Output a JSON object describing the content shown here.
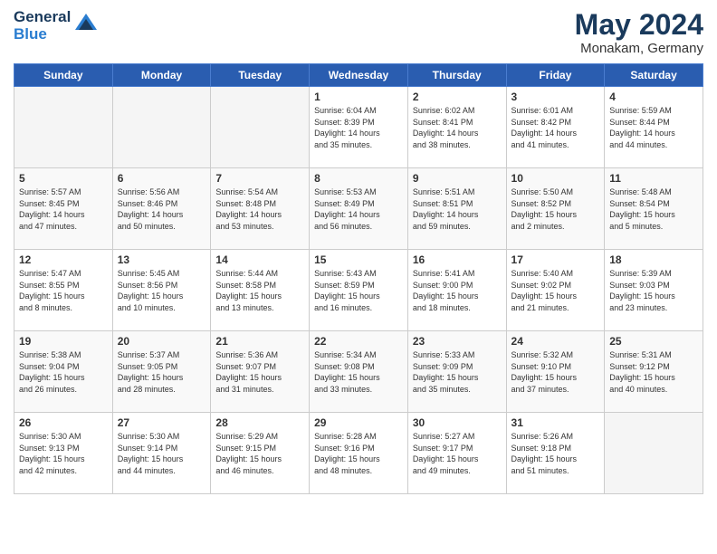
{
  "header": {
    "logo_line1": "General",
    "logo_line2": "Blue",
    "month_year": "May 2024",
    "location": "Monakam, Germany"
  },
  "weekdays": [
    "Sunday",
    "Monday",
    "Tuesday",
    "Wednesday",
    "Thursday",
    "Friday",
    "Saturday"
  ],
  "weeks": [
    [
      {
        "day": "",
        "info": ""
      },
      {
        "day": "",
        "info": ""
      },
      {
        "day": "",
        "info": ""
      },
      {
        "day": "1",
        "info": "Sunrise: 6:04 AM\nSunset: 8:39 PM\nDaylight: 14 hours\nand 35 minutes."
      },
      {
        "day": "2",
        "info": "Sunrise: 6:02 AM\nSunset: 8:41 PM\nDaylight: 14 hours\nand 38 minutes."
      },
      {
        "day": "3",
        "info": "Sunrise: 6:01 AM\nSunset: 8:42 PM\nDaylight: 14 hours\nand 41 minutes."
      },
      {
        "day": "4",
        "info": "Sunrise: 5:59 AM\nSunset: 8:44 PM\nDaylight: 14 hours\nand 44 minutes."
      }
    ],
    [
      {
        "day": "5",
        "info": "Sunrise: 5:57 AM\nSunset: 8:45 PM\nDaylight: 14 hours\nand 47 minutes."
      },
      {
        "day": "6",
        "info": "Sunrise: 5:56 AM\nSunset: 8:46 PM\nDaylight: 14 hours\nand 50 minutes."
      },
      {
        "day": "7",
        "info": "Sunrise: 5:54 AM\nSunset: 8:48 PM\nDaylight: 14 hours\nand 53 minutes."
      },
      {
        "day": "8",
        "info": "Sunrise: 5:53 AM\nSunset: 8:49 PM\nDaylight: 14 hours\nand 56 minutes."
      },
      {
        "day": "9",
        "info": "Sunrise: 5:51 AM\nSunset: 8:51 PM\nDaylight: 14 hours\nand 59 minutes."
      },
      {
        "day": "10",
        "info": "Sunrise: 5:50 AM\nSunset: 8:52 PM\nDaylight: 15 hours\nand 2 minutes."
      },
      {
        "day": "11",
        "info": "Sunrise: 5:48 AM\nSunset: 8:54 PM\nDaylight: 15 hours\nand 5 minutes."
      }
    ],
    [
      {
        "day": "12",
        "info": "Sunrise: 5:47 AM\nSunset: 8:55 PM\nDaylight: 15 hours\nand 8 minutes."
      },
      {
        "day": "13",
        "info": "Sunrise: 5:45 AM\nSunset: 8:56 PM\nDaylight: 15 hours\nand 10 minutes."
      },
      {
        "day": "14",
        "info": "Sunrise: 5:44 AM\nSunset: 8:58 PM\nDaylight: 15 hours\nand 13 minutes."
      },
      {
        "day": "15",
        "info": "Sunrise: 5:43 AM\nSunset: 8:59 PM\nDaylight: 15 hours\nand 16 minutes."
      },
      {
        "day": "16",
        "info": "Sunrise: 5:41 AM\nSunset: 9:00 PM\nDaylight: 15 hours\nand 18 minutes."
      },
      {
        "day": "17",
        "info": "Sunrise: 5:40 AM\nSunset: 9:02 PM\nDaylight: 15 hours\nand 21 minutes."
      },
      {
        "day": "18",
        "info": "Sunrise: 5:39 AM\nSunset: 9:03 PM\nDaylight: 15 hours\nand 23 minutes."
      }
    ],
    [
      {
        "day": "19",
        "info": "Sunrise: 5:38 AM\nSunset: 9:04 PM\nDaylight: 15 hours\nand 26 minutes."
      },
      {
        "day": "20",
        "info": "Sunrise: 5:37 AM\nSunset: 9:05 PM\nDaylight: 15 hours\nand 28 minutes."
      },
      {
        "day": "21",
        "info": "Sunrise: 5:36 AM\nSunset: 9:07 PM\nDaylight: 15 hours\nand 31 minutes."
      },
      {
        "day": "22",
        "info": "Sunrise: 5:34 AM\nSunset: 9:08 PM\nDaylight: 15 hours\nand 33 minutes."
      },
      {
        "day": "23",
        "info": "Sunrise: 5:33 AM\nSunset: 9:09 PM\nDaylight: 15 hours\nand 35 minutes."
      },
      {
        "day": "24",
        "info": "Sunrise: 5:32 AM\nSunset: 9:10 PM\nDaylight: 15 hours\nand 37 minutes."
      },
      {
        "day": "25",
        "info": "Sunrise: 5:31 AM\nSunset: 9:12 PM\nDaylight: 15 hours\nand 40 minutes."
      }
    ],
    [
      {
        "day": "26",
        "info": "Sunrise: 5:30 AM\nSunset: 9:13 PM\nDaylight: 15 hours\nand 42 minutes."
      },
      {
        "day": "27",
        "info": "Sunrise: 5:30 AM\nSunset: 9:14 PM\nDaylight: 15 hours\nand 44 minutes."
      },
      {
        "day": "28",
        "info": "Sunrise: 5:29 AM\nSunset: 9:15 PM\nDaylight: 15 hours\nand 46 minutes."
      },
      {
        "day": "29",
        "info": "Sunrise: 5:28 AM\nSunset: 9:16 PM\nDaylight: 15 hours\nand 48 minutes."
      },
      {
        "day": "30",
        "info": "Sunrise: 5:27 AM\nSunset: 9:17 PM\nDaylight: 15 hours\nand 49 minutes."
      },
      {
        "day": "31",
        "info": "Sunrise: 5:26 AM\nSunset: 9:18 PM\nDaylight: 15 hours\nand 51 minutes."
      },
      {
        "day": "",
        "info": ""
      }
    ]
  ]
}
